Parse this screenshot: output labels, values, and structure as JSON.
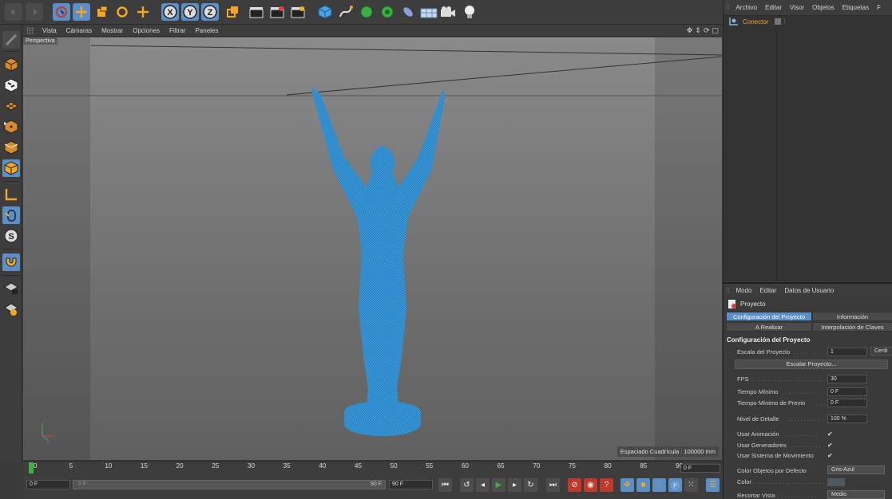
{
  "toolbar": {
    "buttons": [
      {
        "name": "undo-button",
        "icon": "undo-icon"
      },
      {
        "name": "redo-button",
        "icon": "redo-icon"
      },
      {
        "name": "select-tool-button",
        "icon": "cursor-icon"
      },
      {
        "name": "move-tool-button",
        "icon": "move-arrows-icon"
      },
      {
        "name": "scale-tool-button",
        "icon": "scale-icon"
      },
      {
        "name": "rotate-tool-button",
        "icon": "rotate-icon"
      },
      {
        "name": "last-tool-button",
        "icon": "plus-icon"
      },
      {
        "name": "x-axis-button",
        "icon": "x-axis-icon",
        "label": "X"
      },
      {
        "name": "y-axis-button",
        "icon": "y-axis-icon",
        "label": "Y"
      },
      {
        "name": "z-axis-button",
        "icon": "z-axis-icon",
        "label": "Z"
      },
      {
        "name": "coordinate-system-button",
        "icon": "coordinate-icon"
      },
      {
        "name": "render-view-button",
        "icon": "clapper-icon"
      },
      {
        "name": "render-picture-viewer-button",
        "icon": "clapper-play-icon"
      },
      {
        "name": "render-settings-button",
        "icon": "clapper-gear-icon"
      },
      {
        "name": "cube-object-button",
        "icon": "cube-icon"
      },
      {
        "name": "spline-button",
        "icon": "pen-icon"
      },
      {
        "name": "subdivision-button",
        "icon": "nurbs-icon"
      },
      {
        "name": "array-button",
        "icon": "array-icon"
      },
      {
        "name": "deformer-button",
        "icon": "deformer-icon"
      },
      {
        "name": "floor-button",
        "icon": "floor-icon"
      },
      {
        "name": "camera-button",
        "icon": "camera-icon"
      },
      {
        "name": "light-button",
        "icon": "light-icon"
      }
    ]
  },
  "left_toolbar": {
    "buttons": [
      "make-editable-icon",
      "model-mode-icon",
      "texture-mode-icon",
      "workplane-icon",
      "points-mode-icon",
      "edges-mode-icon",
      "polygons-mode-icon",
      "axis-mode-icon",
      "tweak-mode-icon",
      "solo-icon",
      "snap-icon",
      "lock-workplane-icon",
      "planar-workplane-icon"
    ]
  },
  "viewport": {
    "menu": [
      "Vista",
      "Cámaras",
      "Mostrar",
      "Opciones",
      "Filtrar",
      "Paneles"
    ],
    "label": "Perspectiva",
    "grid_spacing": "Espaciado Cuadrícula : 100000 mm"
  },
  "timeline": {
    "ticks": [
      "0",
      "5",
      "10",
      "15",
      "20",
      "25",
      "30",
      "35",
      "40",
      "45",
      "50",
      "55",
      "60",
      "65",
      "70",
      "75",
      "80",
      "85",
      "90"
    ],
    "current_frame": "0 F"
  },
  "transport": {
    "start_field": "0 F",
    "preview_start": "0 F",
    "preview_end": "90 F",
    "end_field": "90 F"
  },
  "objects_panel": {
    "menu": [
      "Archivo",
      "Editar",
      "Visor",
      "Objetos",
      "Etiquetas",
      "F"
    ],
    "object_name": "Conector"
  },
  "attributes_panel": {
    "menu": [
      "Modo",
      "Editar",
      "Datos de Usuario"
    ],
    "title": "Proyecto",
    "tabs": [
      "Configuración del Proyecto",
      "Información",
      "A Realizar",
      "Interpolación de Claves"
    ],
    "section_title": "Configuración del Proyecto",
    "scale_label": "Escala del Proyecto",
    "scale_value": "1",
    "scale_unit": "Centi",
    "scale_button": "Escalar Proyecto...",
    "fps_label": "FPS",
    "fps_value": "30",
    "min_time_label": "Tiempo Mínimo",
    "min_time_value": "0 F",
    "min_preview_label": "Tiempo Mínimo de Previo",
    "min_preview_value": "0 F",
    "lod_label": "Nivel de Detalle",
    "lod_value": "100 %",
    "use_anim_label": "Usar Animación",
    "use_gen_label": "Usar Generadores",
    "use_motion_label": "Usar Sistema de Movimiento",
    "check_mark": "✔",
    "obj_color_label": "Color Objetos por Defecto",
    "obj_color_value": "Gris-Azul",
    "color_label": "Color",
    "clip_label": "Recortar Vista",
    "clip_value": "Medio"
  },
  "colors": {
    "accent": "#5b8fc7",
    "mesh": "#3a9ad9",
    "object_name": "#f0a030"
  }
}
